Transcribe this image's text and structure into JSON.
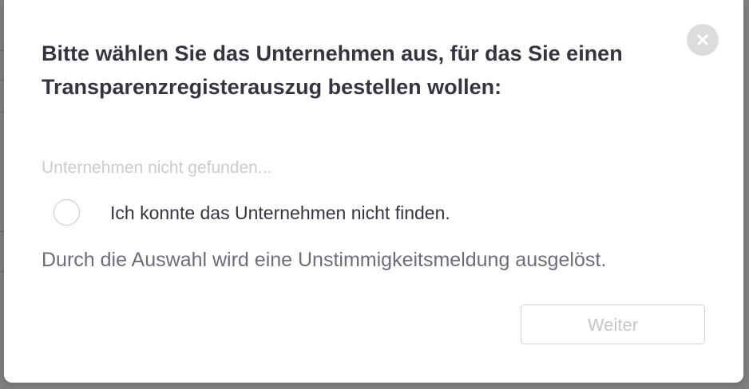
{
  "dialog": {
    "title": "Bitte wählen Sie das Unternehmen aus, für das Sie einen Transparenzregisterauszug bestellen wollen:",
    "close_icon": "close-icon",
    "not_found_text": "Unternehmen nicht gefunden...",
    "option": {
      "label": "Ich konnte das Unternehmen nicht finden.",
      "selected": false
    },
    "hint": "Durch die Auswahl wird eine Unstimmigkeitsmeldung ausgelöst.",
    "next_button": {
      "label": "Weiter",
      "enabled": false
    }
  },
  "colors": {
    "title": "#33363f",
    "muted": "#c9cbd0",
    "hint": "#6b6e78",
    "close_bg": "#dcdcdf",
    "backdrop": "#808080"
  }
}
